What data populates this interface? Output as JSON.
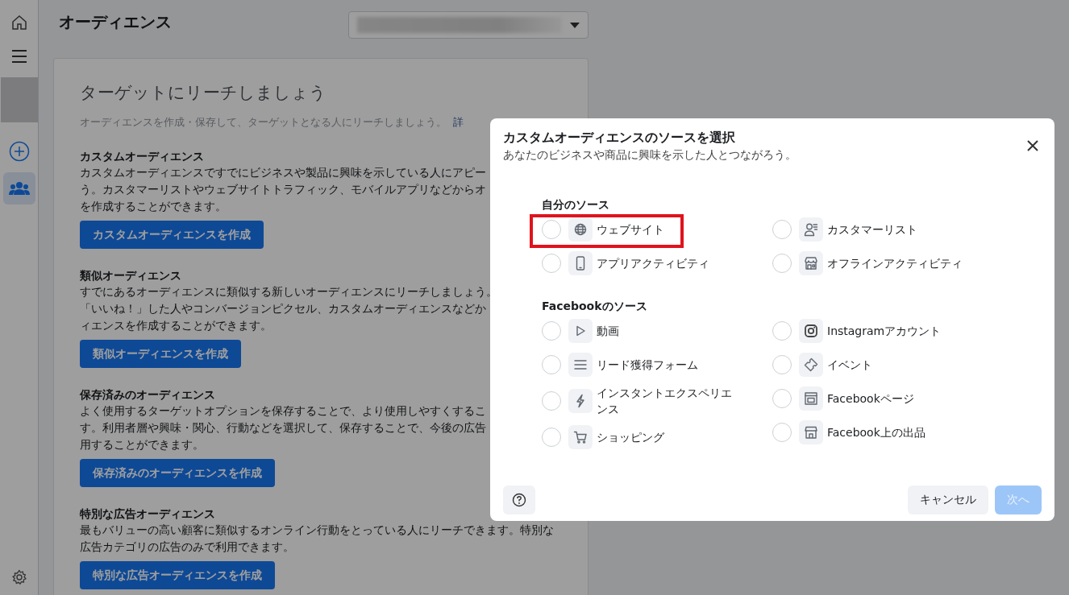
{
  "sidebar": {
    "items": [
      {
        "kind": "home",
        "selected": false
      },
      {
        "kind": "menu",
        "selected": false
      },
      {
        "kind": "account",
        "selected": false
      },
      {
        "kind": "add",
        "selected": false
      },
      {
        "kind": "audiences",
        "selected": true
      },
      {
        "kind": "settings",
        "selected": false
      }
    ]
  },
  "page": {
    "title": "オーディエンス"
  },
  "card": {
    "title": "ターゲットにリーチしましょう",
    "intro": "オーディエンスを作成・保存して、ターゲットとなる人にリーチしましょう。",
    "intro_link": "詳",
    "sections": [
      {
        "heading": "カスタムオーディエンス",
        "lines": [
          "カスタムオーディエンスですでにビジネスや製品に興味を示している人にアピー",
          "う。カスタマーリストやウェブサイトトラフィック、モバイルアプリなどからオ",
          "を作成することができます。"
        ],
        "button": "カスタムオーディエンスを作成"
      },
      {
        "heading": "類似オーディエンス",
        "lines": [
          "すでにあるオーディエンスに類似する新しいオーディエンスにリーチしましょう。",
          "「いいね！」した人やコンバージョンピクセル、カスタムオーディエンスなどか",
          "ィエンスを作成することができます。"
        ],
        "button": "類似オーディエンスを作成"
      },
      {
        "heading": "保存済みのオーディエンス",
        "lines": [
          "よく使用するターゲットオプションを保存することで、より使用しやすくするこ",
          "す。利用者層や興味・関心、行動などを選択して、保存することで、今後の広告",
          "用することができます。"
        ],
        "button": "保存済みのオーディエンスを作成"
      },
      {
        "heading": "特別な広告オーディエンス",
        "lines": [
          "最もバリューの高い顧客に類似するオンライン行動をとっている人にリーチできます。特別な",
          "広告カテゴリの広告のみで利用できます。"
        ],
        "button": "特別な広告オーディエンスを作成"
      }
    ]
  },
  "modal": {
    "title": "カスタムオーディエンスのソースを選択",
    "subtitle": "あなたのビジネスや商品に興味を示した人とつながろう。",
    "groups": [
      {
        "heading": "自分のソース",
        "columns": [
          [
            {
              "kind": "website",
              "label": "ウェブサイト",
              "selected": false,
              "highlighted": true
            },
            {
              "kind": "app",
              "label": "アプリアクティビティ",
              "selected": false,
              "highlighted": false
            }
          ],
          [
            {
              "kind": "customer_list",
              "label": "カスタマーリスト",
              "selected": false,
              "highlighted": false
            },
            {
              "kind": "offline",
              "label": "オフラインアクティビティ",
              "selected": false,
              "highlighted": false
            }
          ]
        ]
      },
      {
        "heading": "Facebookのソース",
        "columns": [
          [
            {
              "kind": "video",
              "label": "動画",
              "selected": false,
              "highlighted": false
            },
            {
              "kind": "lead_form",
              "label": "リード獲得フォーム",
              "selected": false,
              "highlighted": false
            },
            {
              "kind": "instant_experience",
              "label": "インスタントエクスペリエンス",
              "selected": false,
              "highlighted": false
            },
            {
              "kind": "shopping",
              "label": "ショッピング",
              "selected": false,
              "highlighted": false
            }
          ],
          [
            {
              "kind": "instagram",
              "label": "Instagramアカウント",
              "selected": false,
              "highlighted": false
            },
            {
              "kind": "event",
              "label": "イベント",
              "selected": false,
              "highlighted": false
            },
            {
              "kind": "page",
              "label": "Facebookページ",
              "selected": false,
              "highlighted": false
            },
            {
              "kind": "shop",
              "label": "Facebook上の出品",
              "selected": false,
              "highlighted": false
            }
          ]
        ]
      }
    ],
    "cancel_button": "キャンセル",
    "next_button": {
      "label": "次へ",
      "disabled": true
    }
  }
}
